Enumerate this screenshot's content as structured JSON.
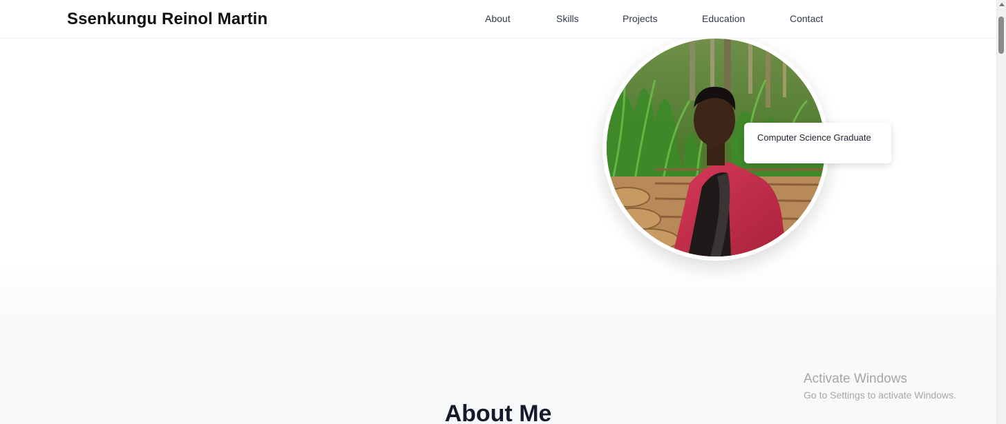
{
  "header": {
    "brand": "Ssenkungu Reinol Martin",
    "nav": [
      "About",
      "Skills",
      "Projects",
      "Education",
      "Contact"
    ]
  },
  "hero": {
    "badge": "Computer Science Graduate"
  },
  "about": {
    "heading": "About Me"
  },
  "watermark": {
    "title": "Activate Windows",
    "subtitle": "Go to Settings to activate Windows."
  },
  "colors": {
    "text_primary": "#111111",
    "nav_text": "#2f3a4a",
    "section_bg": "#f8f9fb",
    "watermark": "#a6a6a6"
  }
}
